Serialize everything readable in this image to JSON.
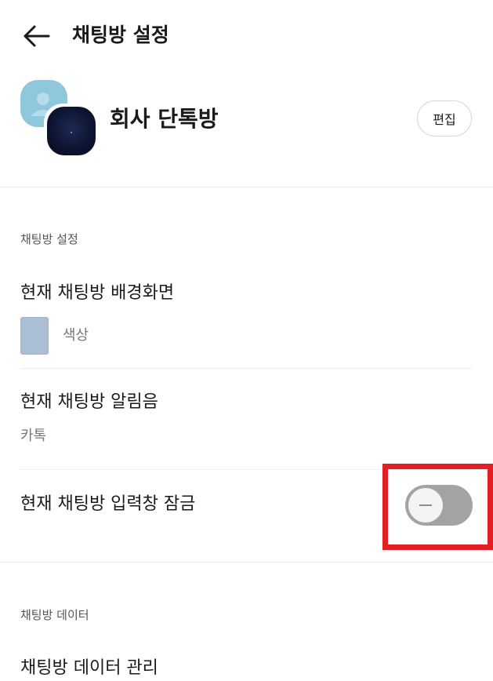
{
  "header": {
    "back_icon": "arrow-left-icon",
    "title": "채팅방 설정"
  },
  "profile": {
    "room_name": "회사 단톡방",
    "edit_label": "편집",
    "avatar_back_color": "#8fc7dc",
    "avatar_front_color": "#0e1533"
  },
  "settings_section": {
    "label": "채팅방 설정",
    "items": [
      {
        "title": "현재 채팅방 배경화면",
        "value": "색상",
        "swatch_color": "#aabfd4"
      },
      {
        "title": "현재 채팅방 알림음",
        "value": "카톡"
      },
      {
        "title": "현재 채팅방 입력창 잠금",
        "toggle_state": "off"
      }
    ]
  },
  "data_section": {
    "label": "채팅방 데이터",
    "items": [
      {
        "title": "채팅방 데이터 관리"
      }
    ]
  },
  "colors": {
    "highlight": "#e41e25",
    "toggle_off": "#a3a3a3"
  }
}
